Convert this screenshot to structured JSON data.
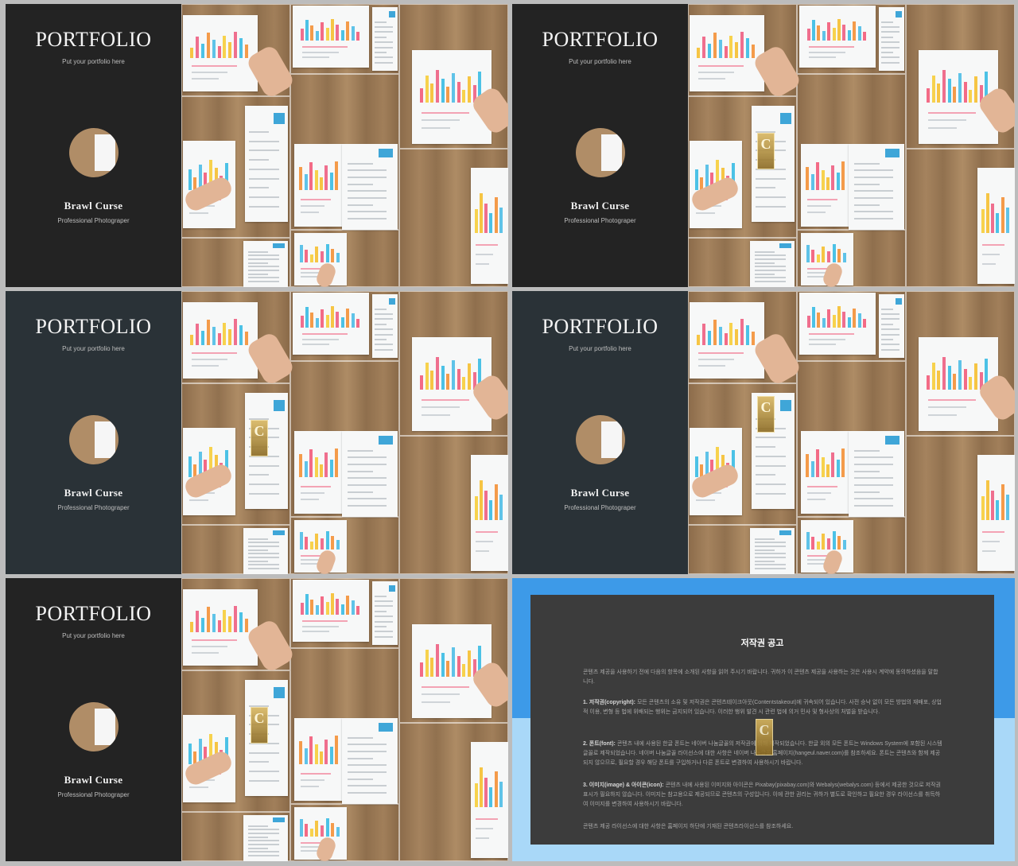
{
  "slides": [
    {
      "title": "PORTFOLIO",
      "subtitle": "Put your portfolio here",
      "name": "Brawl Curse",
      "role": "Professional Photograper"
    },
    {
      "title": "PORTFOLIO",
      "subtitle": "Put your portfolio here",
      "name": "Brawl Curse",
      "role": "Professional Photograper"
    },
    {
      "title": "PORTFOLIO",
      "subtitle": "Put your portfolio here",
      "name": "Brawl Curse",
      "role": "Professional Photograper"
    },
    {
      "title": "PORTFOLIO",
      "subtitle": "Put your portfolio here",
      "name": "Brawl Curse",
      "role": "Professional Photograper"
    },
    {
      "title": "PORTFOLIO",
      "subtitle": "Put your portfolio here",
      "name": "Brawl Curse",
      "role": "Professional Photograper"
    }
  ],
  "copyright": {
    "title": "저작권 공고",
    "intro": "콘텐츠 제공을 사용하기 전에 다음의 항목에 소개된 사항을 읽어 주시기 바랍니다. 귀하가 이 콘텐츠 제공을 사용하는 것은 사용시 계약에 동의하셨음을 말합니다.",
    "s1_head": "1. 저작권(copyright):",
    "s1_body": "모든 콘텐츠의 소유 및 저작권은 콘텐츠테이크아웃(Contentstakeout)에 귀속되어 있습니다. 사전 승낙 없이 모든 방법의 재배포, 상업적 이용, 변형 등 법에 위배되는 행위는 금지되어 있습니다. 이러한 행위 발견 시 관련 법에 의거 민사 및 형사상의 처벌을 받습니다.",
    "s2_head": "2. 폰트(font):",
    "s2_body": "콘텐츠 내에 사용된 한글 폰트는 네이버 나눔글꼴의 저작권에 의해 제작되었습니다. 한글 외의 모든 폰트는 Windows System에 포함된 시스템 글꼴로 제작되었습니다. 네이버 나눔글꼴 라이선스에 대한 사항은 네이버 나눔글꼴 홈페이지(hangeul.naver.com)를 참조하세요. 폰트는 콘텐츠와 함께 제공되지 않으므로, 필요할 경우 해당 폰트를 구입하거나 다른 폰트로 변경하여 사용하시기 바랍니다.",
    "s3_head": "3. 이미지(image) & 아이콘(icon):",
    "s3_body": "콘텐츠 내에 사용된 이미지와 아이콘은 Pixabay(pixabay.com)와 Webalys(webalys.com) 등에서 제공한 것으로 저작권 표시가 필요하지 않습니다. 이미지는 참고용으로 제공되므로 콘텐츠의 구성입니다. 이에 관한 권리는 귀하가 별도로 확인하고 필요한 경우 라이선스를 취득하여 이미지를 변경하여 사용하시기 바랍니다.",
    "outro": "콘텐츠 제공 라이선스에 대한 사항은 홈페이지 하단에 기재된 콘텐츠라이선스를 참조하세요."
  },
  "watermark": {
    "letter": "C"
  }
}
